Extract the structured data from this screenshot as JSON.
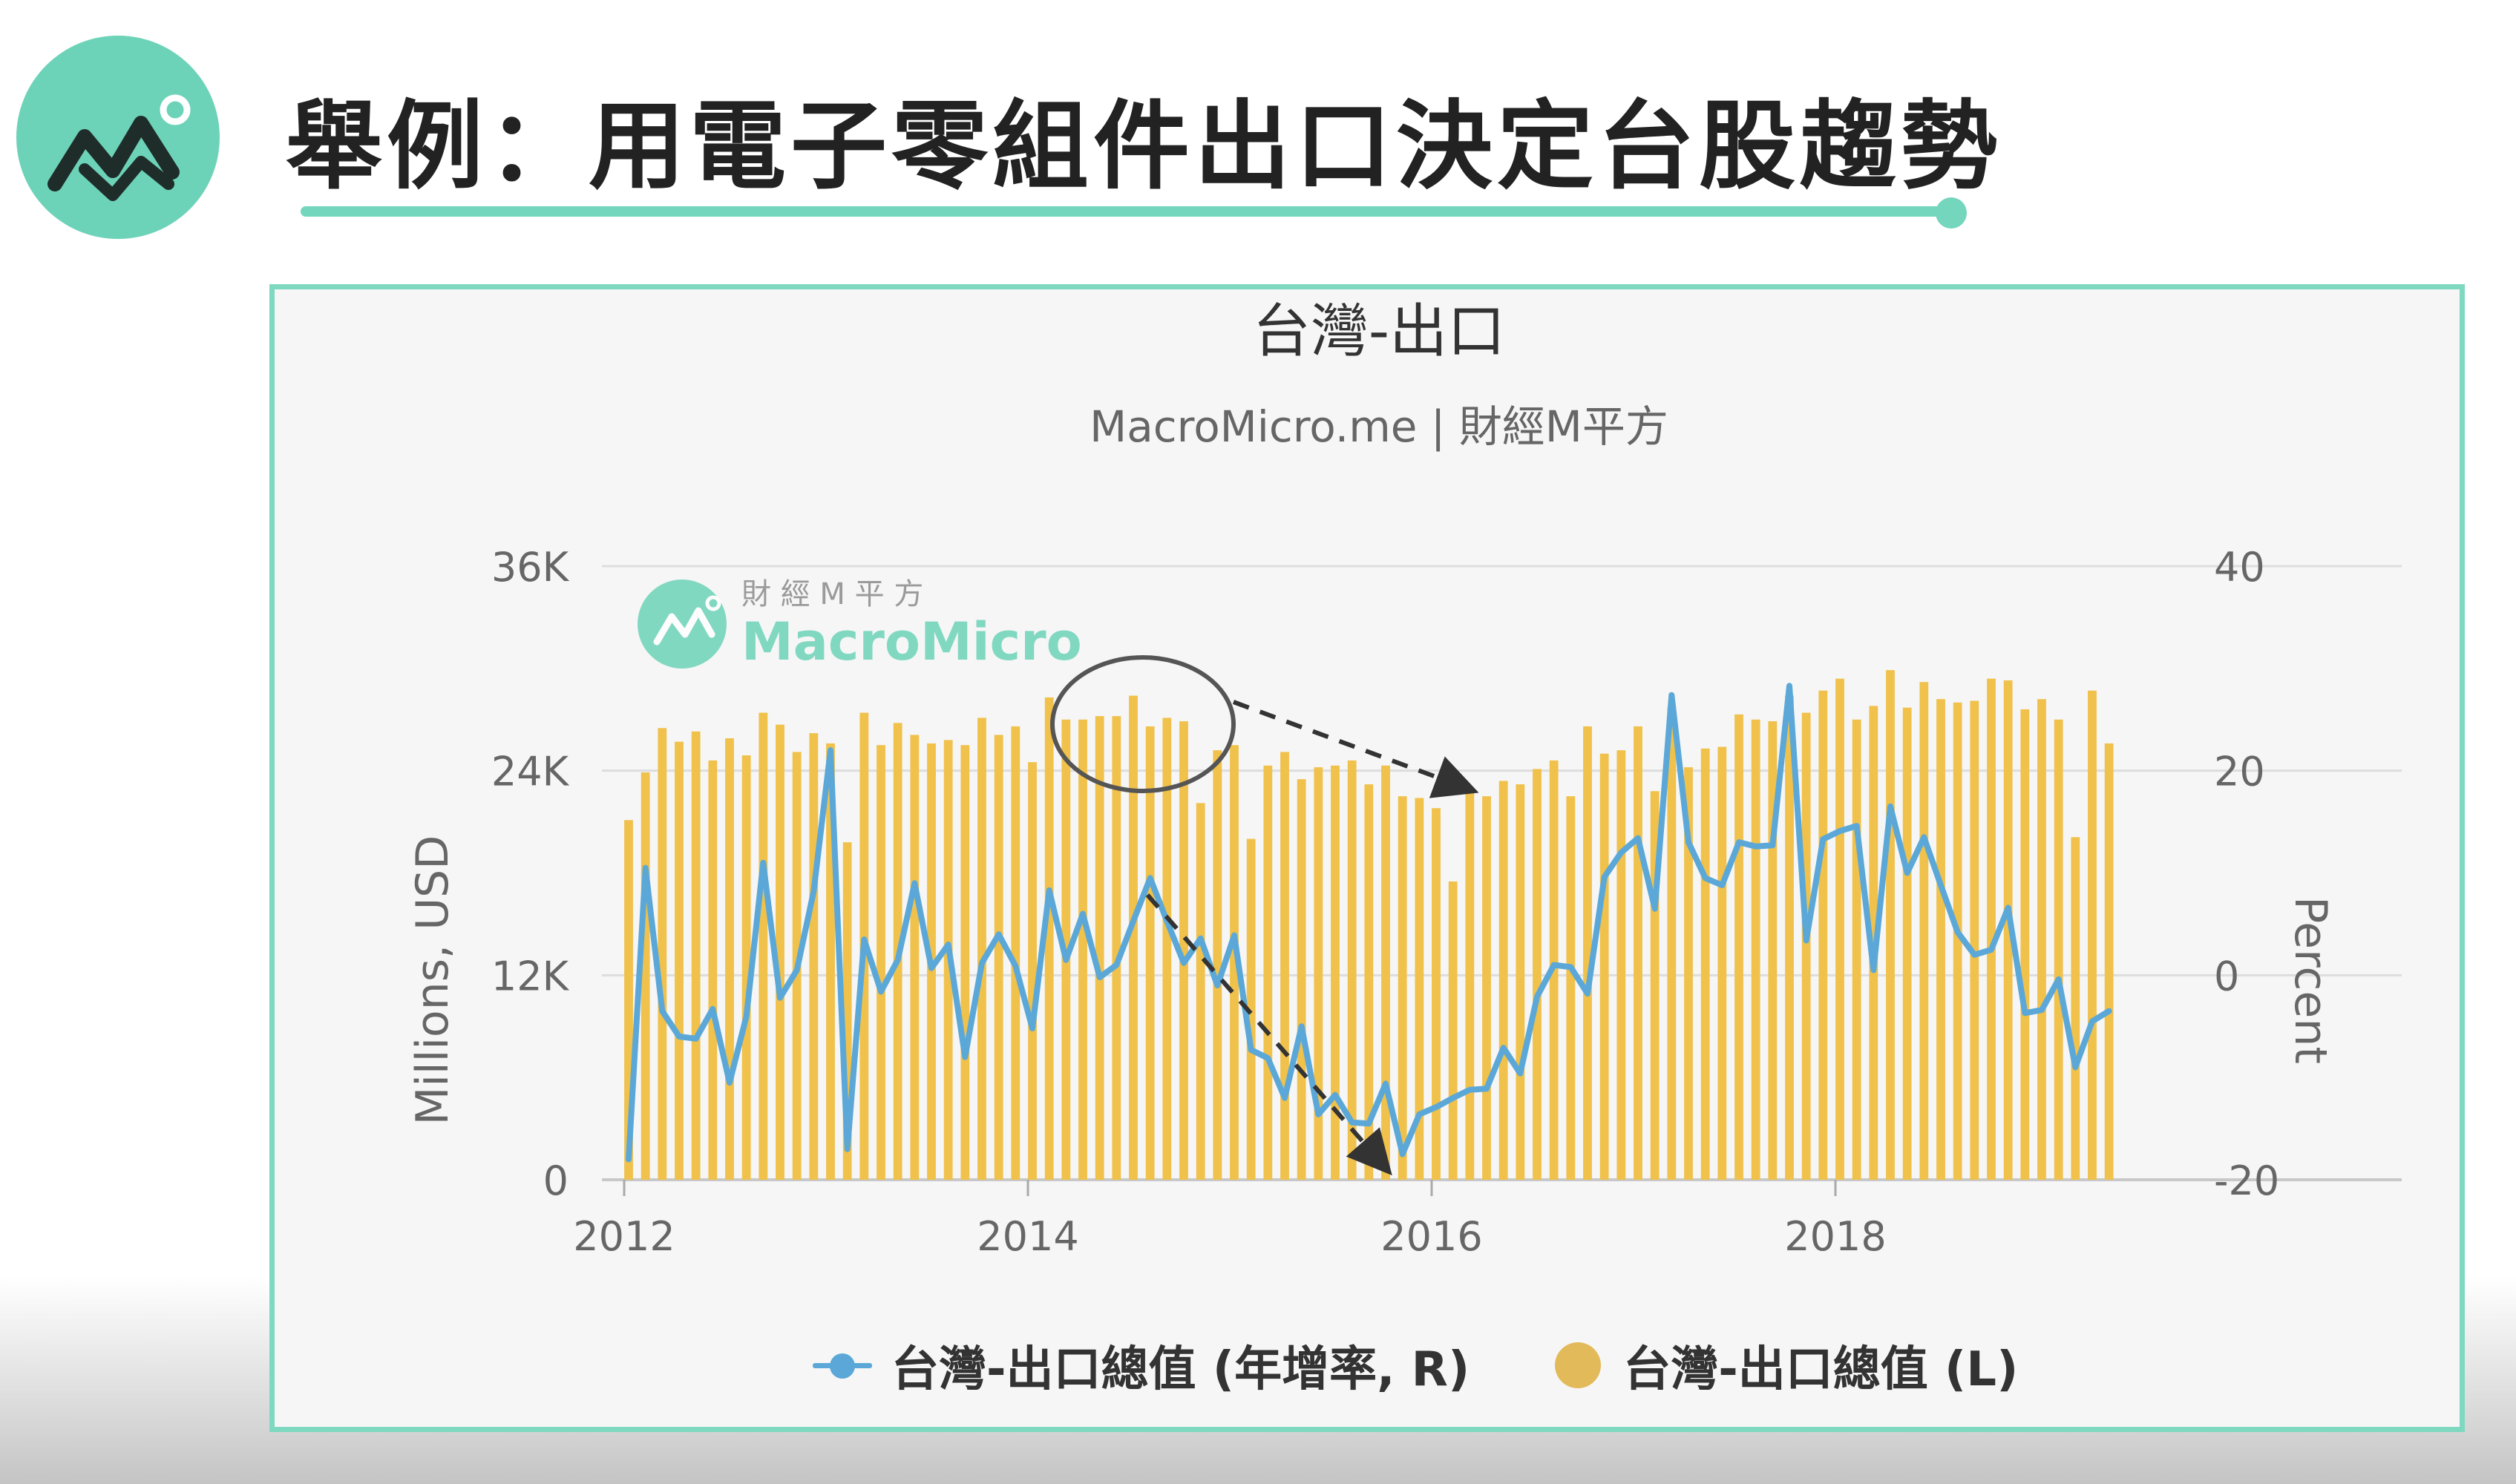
{
  "page": {
    "title": "舉例：用電子零組件出口決定台股趨勢"
  },
  "watermark": {
    "line1": "財 經 M 平 方",
    "line2": "MacroMicro"
  },
  "colors": {
    "accent": "#6dd3b8",
    "bar": "#f0c14b",
    "line": "#5ba8d8",
    "legend_bar": "#e3ba5a"
  },
  "chart_data": {
    "type": "bar",
    "title": "台灣-出口",
    "subtitle": "MacroMicro.me | 財經M平方",
    "ylabel_left": "Millions, USD",
    "ylabel_right": "Percent",
    "ylim_left": [
      0,
      36000
    ],
    "ylim_right": [
      -20,
      40
    ],
    "yticks_left": [
      "36K",
      "24K",
      "12K",
      "0"
    ],
    "yticks_right": [
      "40",
      "20",
      "0",
      "-20"
    ],
    "xticks": [
      "2012",
      "2014",
      "2016",
      "2018"
    ],
    "x_start": "2012-01",
    "grid": true,
    "legend_position": "bottom",
    "series": [
      {
        "name": "台灣-出口總值 (年增率, R)",
        "type": "line",
        "axis": "right",
        "values": [
          -18,
          10.5,
          -3.5,
          -6,
          -6.2,
          -3.3,
          -10.5,
          -4,
          11,
          -2.2,
          0.5,
          8.2,
          22,
          -17,
          3.5,
          -1.6,
          1.5,
          9,
          0.7,
          3,
          -8,
          1.2,
          4,
          0.9,
          -5.2,
          8.3,
          1.5,
          6,
          -0.2,
          1,
          5.3,
          9.5,
          5.3,
          1.2,
          3.6,
          -1,
          3.9,
          -7.3,
          -8.1,
          -12,
          -5,
          -13.6,
          -11.7,
          -14.4,
          -14.5,
          -10.6,
          -17.5,
          -13.6,
          -12.9,
          -12,
          -11.2,
          -11.1,
          -7.1,
          -9.6,
          -2.1,
          1,
          0.8,
          -1.8,
          9.6,
          12,
          13.4,
          6.5,
          27.4,
          13,
          9.5,
          8.8,
          13,
          12.6,
          12.7,
          28.3,
          3.4,
          13.3,
          14.1,
          14.6,
          0.5,
          16.5,
          10,
          13.5,
          8.8,
          4.2,
          2,
          2.5,
          6.6,
          -3.7,
          -3.4,
          -0.4,
          -9,
          -4.5,
          -3.5
        ]
      },
      {
        "name": "台灣-出口總值 (L)",
        "type": "bar",
        "axis": "left",
        "values": [
          21100,
          23900,
          26500,
          25700,
          26300,
          24600,
          25900,
          24900,
          27400,
          26700,
          25100,
          26200,
          25600,
          19800,
          27400,
          25500,
          26800,
          26100,
          25600,
          25800,
          25500,
          27100,
          26100,
          26600,
          24500,
          28300,
          27000,
          27000,
          27200,
          27200,
          28400,
          26600,
          27100,
          26900,
          22100,
          25200,
          25500,
          20000,
          24300,
          25100,
          23500,
          24200,
          24300,
          24600,
          23200,
          24300,
          22500,
          22400,
          21800,
          17500,
          23000,
          22500,
          23400,
          23200,
          24100,
          24600,
          22500,
          26600,
          25000,
          25200,
          26600,
          22800,
          27700,
          24200,
          25300,
          25400,
          27300,
          27000,
          26900,
          28400,
          27400,
          28700,
          29400,
          27000,
          27800,
          29900,
          27700,
          29200,
          28200,
          28000,
          28100,
          29400,
          29300,
          27600,
          28200,
          27000,
          20100,
          28700,
          25600
        ]
      }
    ],
    "annotations": [
      {
        "type": "ellipse",
        "note": "highlight around 2014 peak"
      },
      {
        "type": "dashed-arrow",
        "note": "downtrend from mid-2014 peak"
      },
      {
        "type": "dashed-arrow",
        "note": "decline of YoY growth 2014-2015"
      }
    ]
  }
}
